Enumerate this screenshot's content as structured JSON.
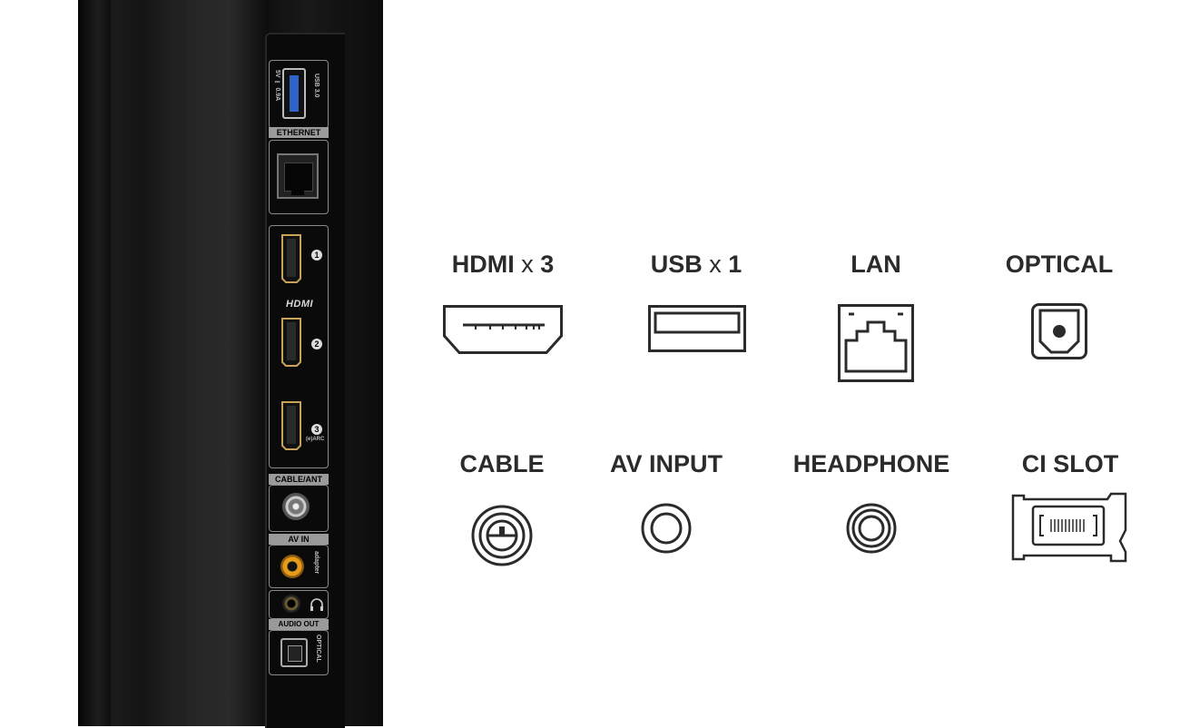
{
  "tv_port_panel": {
    "usb_label": "USB 3.0",
    "usb_rating": "5V ⎓ 0.9A",
    "ethernet_label": "ETHERNET",
    "hdmi_logo": "HDMI",
    "hdmi_ports": [
      {
        "number": "1",
        "note": ""
      },
      {
        "number": "2",
        "note": ""
      },
      {
        "number": "3",
        "note": "(e)ARC"
      }
    ],
    "cable_label": "CABLE/ANT",
    "av_in_label": "AV IN",
    "adapter_label": "adapter",
    "audio_out_label": "AUDIO OUT",
    "optical_label": "OPTICAL"
  },
  "legend": {
    "row1": [
      {
        "name": "HDMI",
        "sep": " x ",
        "count": "3",
        "icon": "hdmi-port-icon"
      },
      {
        "name": "USB",
        "sep": " x ",
        "count": "1",
        "icon": "usb-port-icon"
      },
      {
        "name": "LAN",
        "sep": "",
        "count": "",
        "icon": "lan-port-icon"
      },
      {
        "name": "OPTICAL",
        "sep": "",
        "count": "",
        "icon": "optical-port-icon"
      }
    ],
    "row2": [
      {
        "name": "CABLE",
        "icon": "coax-port-icon"
      },
      {
        "name": "AV INPUT",
        "icon": "av-input-icon"
      },
      {
        "name": "HEADPHONE",
        "icon": "headphone-jack-icon"
      },
      {
        "name": "CI SLOT",
        "icon": "ci-slot-icon"
      }
    ]
  },
  "colors": {
    "usb_blue": "#2f63c9",
    "hdmi_gold": "#c9a25a",
    "av_orange": "#e89b1a",
    "label_dark": "#2b2b2b"
  }
}
